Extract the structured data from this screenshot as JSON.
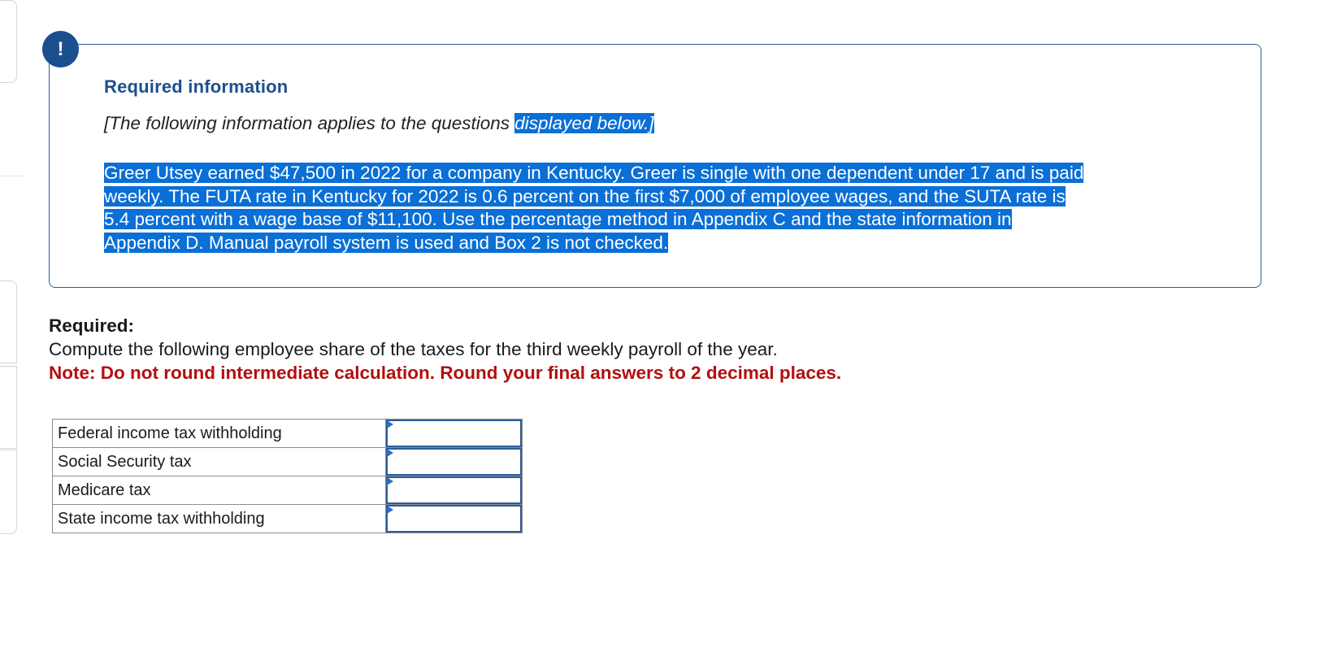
{
  "alert": {
    "icon": "exclamation-icon",
    "glyph": "!",
    "title": "Required information",
    "subtitle_start": "[The following information applies to the questions ",
    "subtitle_highlight": "displayed below.]",
    "body_lines": [
      "Greer Utsey earned $47,500 in 2022 for a company in Kentucky. Greer is single with one dependent under 17 and is paid",
      "weekly. The FUTA rate in Kentucky for 2022 is 0.6 percent on the first $7,000 of employee wages, and the SUTA rate is",
      "5.4 percent with a wage base of $11,100. Use the percentage method in Appendix C and the state information in",
      "Appendix D. Manual payroll system is used and Box 2 is not checked."
    ]
  },
  "required": {
    "label": "Required:",
    "instruction": "Compute the following employee share of the taxes for the third weekly payroll of the year.",
    "note": "Note: Do not round intermediate calculation. Round your final answers to 2 decimal places."
  },
  "answer_table": {
    "rows": [
      {
        "label": "Federal income tax withholding",
        "value": ""
      },
      {
        "label": "Social Security tax",
        "value": ""
      },
      {
        "label": "Medicare tax",
        "value": ""
      },
      {
        "label": "State income tax withholding",
        "value": ""
      }
    ]
  },
  "colors": {
    "accent": "#1c4f8d",
    "highlight": "#0a6fd6",
    "note_red": "#b30f0f"
  }
}
